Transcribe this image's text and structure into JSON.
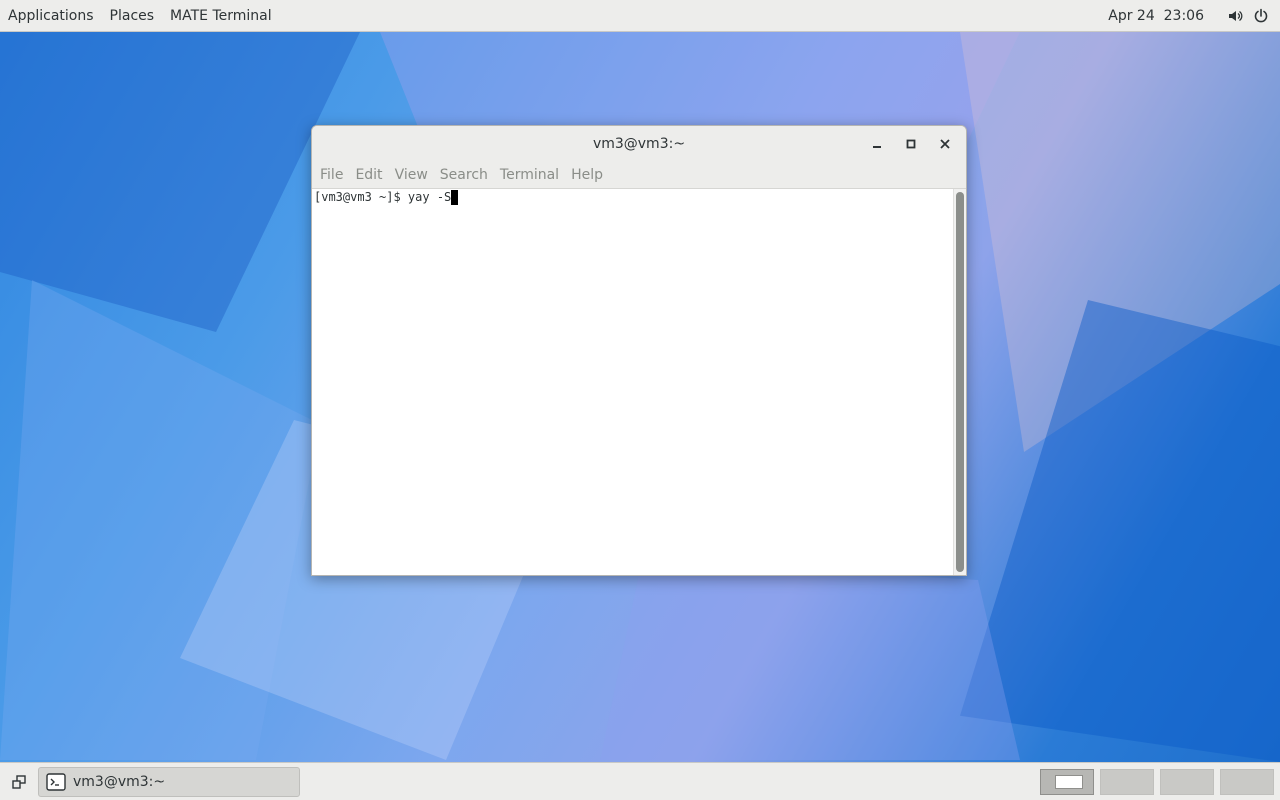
{
  "top_panel": {
    "menus": [
      "Applications",
      "Places",
      "MATE Terminal"
    ],
    "clock": "Apr 24  23:06",
    "icons": [
      "volume-icon",
      "power-icon"
    ]
  },
  "window": {
    "title": "vm3@vm3:~",
    "controls": [
      "minimize-icon",
      "maximize-icon",
      "close-icon"
    ],
    "menu": [
      "File",
      "Edit",
      "View",
      "Search",
      "Terminal",
      "Help"
    ],
    "terminal_line": "[vm3@vm3 ~]$ yay -S"
  },
  "bottom_panel": {
    "task_label": "vm3@vm3:~",
    "workspaces": 4,
    "active_workspace": 1
  }
}
